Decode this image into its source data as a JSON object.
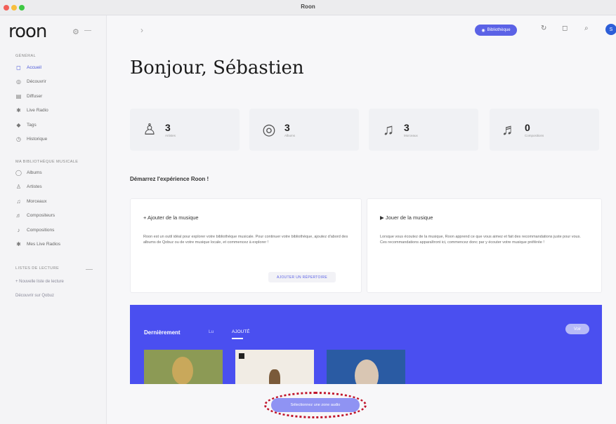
{
  "window": {
    "title": "Roon"
  },
  "sidebar": {
    "logo": "roon",
    "section_main": "GÉNÉRAL",
    "main_items": [
      {
        "label": "Accueil",
        "icon": "home-icon",
        "glyph": "◻",
        "active": true
      },
      {
        "label": "Découvrir",
        "icon": "discover-icon",
        "glyph": "◎",
        "active": false
      },
      {
        "label": "Diffuser",
        "icon": "stream-icon",
        "glyph": "▤",
        "active": false
      },
      {
        "label": "Live Radio",
        "icon": "radio-icon",
        "glyph": "✱",
        "active": false
      },
      {
        "label": "Tags",
        "icon": "tag-icon",
        "glyph": "◆",
        "active": false
      },
      {
        "label": "Historique",
        "icon": "history-icon",
        "glyph": "◷",
        "active": false
      }
    ],
    "section_library": "MA BIBLIOTHÈQUE MUSICALE",
    "library_items": [
      {
        "label": "Albums",
        "icon": "album-icon",
        "glyph": "◯"
      },
      {
        "label": "Artistes",
        "icon": "artist-icon",
        "glyph": "♙"
      },
      {
        "label": "Morceaux",
        "icon": "track-icon",
        "glyph": "♫"
      },
      {
        "label": "Compositeurs",
        "icon": "composer-icon",
        "glyph": "♬"
      },
      {
        "label": "Compositions",
        "icon": "composition-icon",
        "glyph": "♪"
      },
      {
        "label": "Mes Live Radios",
        "icon": "my-radio-icon",
        "glyph": "✱"
      }
    ],
    "section_playlists": "LISTES DE LECTURE",
    "new_playlist": "+ Nouvelle liste de lecture",
    "link_text": "Découvrir sur Qobuz"
  },
  "topbar": {
    "nav_arrow": "›",
    "pill_label": "Bibliothèque",
    "avatar_letter": "S"
  },
  "main": {
    "greeting": "Bonjour, Sébastien",
    "stats": [
      {
        "value": "3",
        "label": "Artistes",
        "icon": "artist-icon",
        "glyph": "♙"
      },
      {
        "value": "3",
        "label": "Albums",
        "icon": "album-icon",
        "glyph": "◎"
      },
      {
        "value": "3",
        "label": "Morceaux",
        "icon": "track-icon",
        "glyph": "♫"
      },
      {
        "value": "0",
        "label": "Compositions",
        "icon": "composition-icon",
        "glyph": "♬"
      }
    ],
    "start_heading": "Démarrez l'expérience Roon !",
    "card_add": {
      "title": "+ Ajouter de la musique",
      "text": "Roon est un outil idéal pour explorer votre bibliothèque musicale. Pour continuer votre bibliothèque, ajoutez d'abord des albums de Qobuz ou de votre musique locale, et commencez à explorer !",
      "button": "AJOUTER UN RÉPERTOIRE"
    },
    "card_play": {
      "title": "▶ Jouer de la musique",
      "text": "Lorsque vous écoutez de la musique, Roon apprend ce que vous aimez et fait des recommandations juste pour vous. Ces recommandations apparaîtront ici, commencez donc par y écouter votre musique préférée !"
    },
    "recent": {
      "title": "Dernièrement",
      "tabs": [
        "Lu",
        "AJOUTÉ"
      ],
      "active_tab": 1,
      "more_button": "Voir"
    },
    "bottom_button": "Sélectionnez une zone audio"
  },
  "colors": {
    "accent": "#5b62e6",
    "recent_bg": "#4a4ff0",
    "highlight": "#c0142b"
  }
}
